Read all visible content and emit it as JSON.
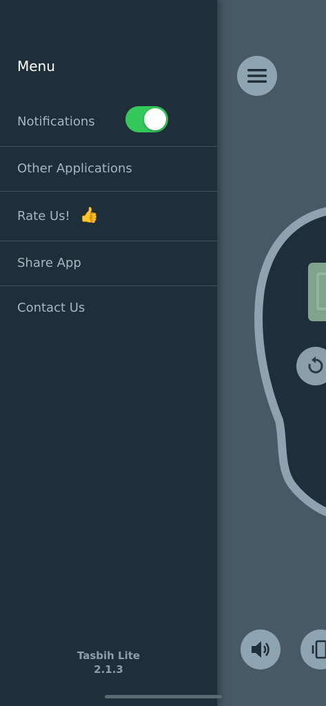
{
  "drawer": {
    "title": "Menu",
    "items": [
      {
        "label": "Notifications"
      },
      {
        "label": "Other Applications"
      },
      {
        "label": "Rate Us!"
      },
      {
        "label": "Share App"
      },
      {
        "label": "Contact Us"
      }
    ],
    "notifications_enabled": true,
    "rate_emoji": "👍"
  },
  "footer": {
    "app_name": "Tasbih Lite",
    "version": "2.1.3"
  },
  "colors": {
    "drawer_bg": "#1f2f39",
    "app_bg": "#475965",
    "toggle_on": "#34c759",
    "lcd": "#7fa38b"
  },
  "icons": [
    "hamburger-icon",
    "reset-icon",
    "speaker-icon",
    "vibrate-icon",
    "thumbs-up-icon"
  ]
}
